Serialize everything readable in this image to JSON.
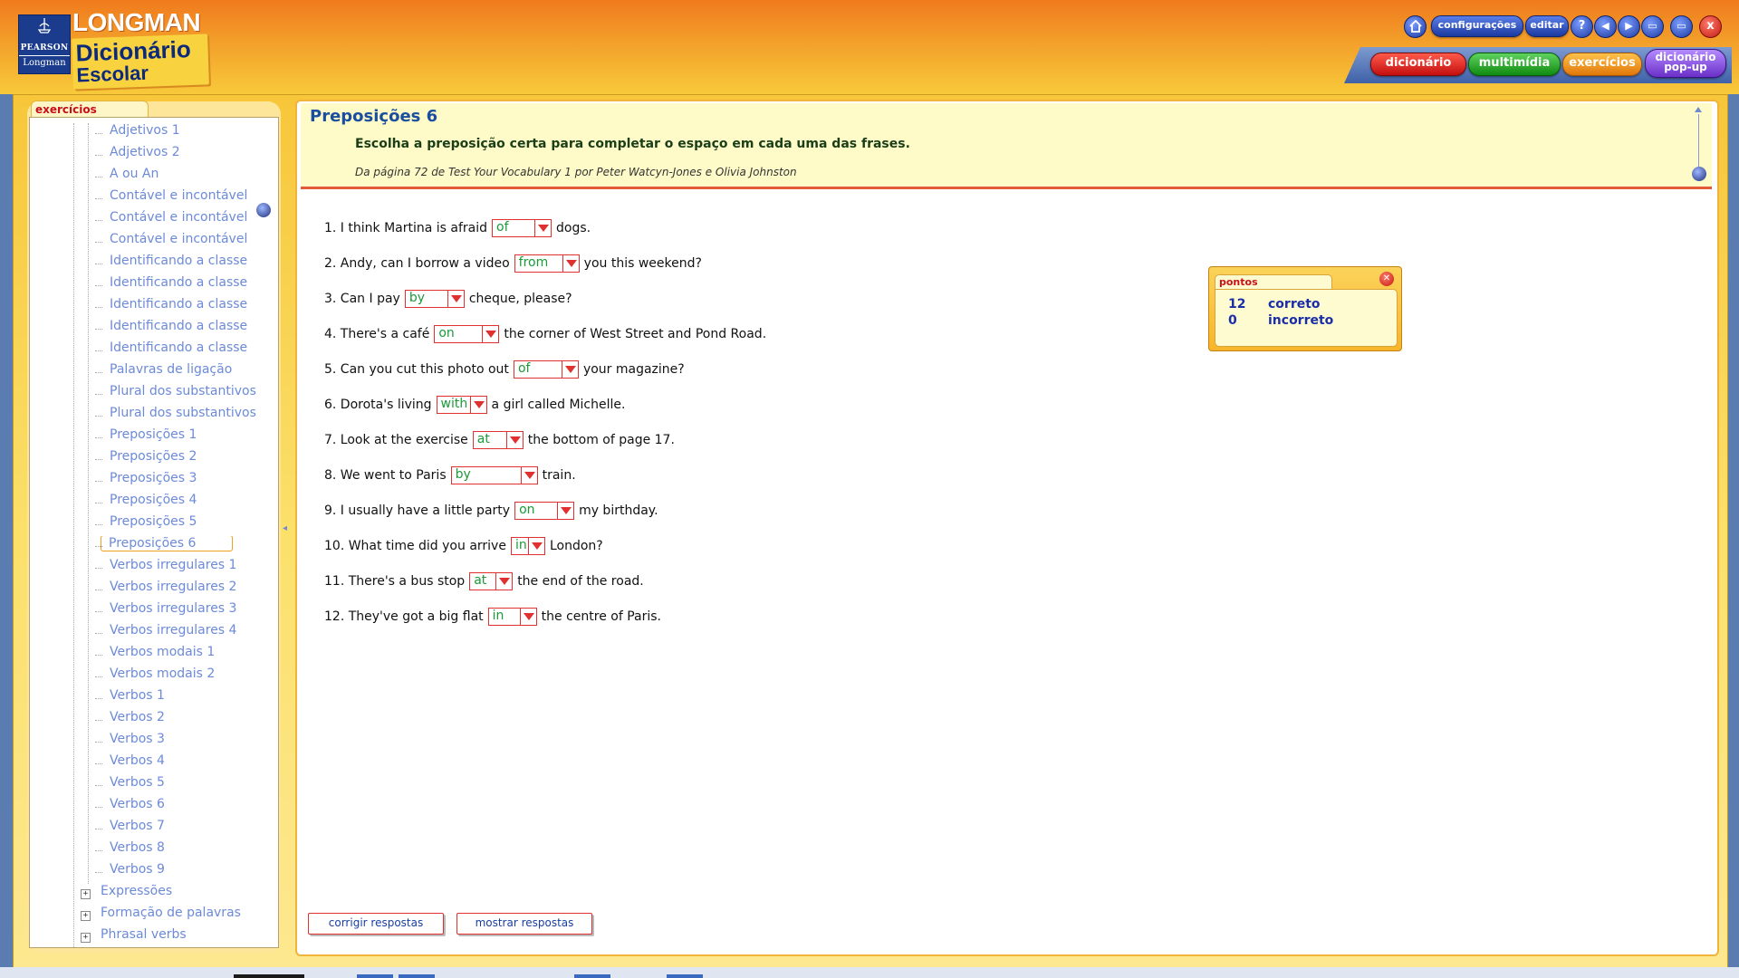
{
  "brand": {
    "publisher": "PEARSON",
    "imprint": "Longman",
    "name": "LONGMAN",
    "title_line1": "Dicionário",
    "title_line2": "Escolar"
  },
  "toolbar": {
    "home_icon": "home-icon",
    "configuracoes": "configurações",
    "editar": "editar",
    "help": "?",
    "back_icon": "arrow-left-icon",
    "forward_icon": "arrow-right-icon",
    "minimize_icon": "minimize-icon",
    "maximize_icon": "maximize-icon",
    "close": "x"
  },
  "section_tabs": {
    "dicionario": "dicionário",
    "multimidia": "multimídia",
    "exercicios": "exercícios",
    "popup_line1": "dicionário",
    "popup_line2": "pop-up"
  },
  "sidebar": {
    "tab_label": "exercícios",
    "items": [
      "Adjetivos 1",
      "Adjetivos 2",
      "A ou An",
      "Contável e incontável",
      "Contável e incontável",
      "Contável e incontável",
      "Identificando a classe",
      "Identificando a classe",
      "Identificando a classe",
      "Identificando a classe",
      "Identificando a classe",
      "Palavras de ligação",
      "Plural dos substantivos",
      "Plural dos substantivos",
      "Preposições 1",
      "Preposições 2",
      "Preposições 3",
      "Preposições 4",
      "Preposições 5",
      "Preposições 6",
      "Verbos irregulares 1",
      "Verbos irregulares 2",
      "Verbos irregulares 3",
      "Verbos irregulares 4",
      "Verbos modais 1",
      "Verbos modais 2",
      "Verbos 1",
      "Verbos 2",
      "Verbos 3",
      "Verbos 4",
      "Verbos 5",
      "Verbos 6",
      "Verbos 7",
      "Verbos 8",
      "Verbos 9"
    ],
    "selected": "Preposições 6",
    "top_items": [
      "Expressões",
      "Formação de palavras",
      "Phrasal verbs"
    ]
  },
  "exercise": {
    "title": "Preposições 6",
    "instruction": "Escolha a preposição certa para completar o espaço em cada uma das frases.",
    "source": "Da página 72 de Test Your Vocabulary 1 por Peter Watcyn-Jones e Olivia Johnston",
    "questions": [
      {
        "before": "1. I think Martina is afraid",
        "answer": "of",
        "after": "dogs."
      },
      {
        "before": "2. Andy, can I borrow a video",
        "answer": "from",
        "after": "you this weekend?"
      },
      {
        "before": "3. Can I pay",
        "answer": "by",
        "after": "cheque, please?"
      },
      {
        "before": "4. There's a café",
        "answer": "on",
        "after": "the corner of West Street and Pond Road."
      },
      {
        "before": "5. Can you cut this photo out",
        "answer": "of",
        "after": "your magazine?"
      },
      {
        "before": "6. Dorota's living",
        "answer": "with",
        "after": "a girl called Michelle."
      },
      {
        "before": "7. Look at the exercise",
        "answer": "at",
        "after": "the bottom of page 17."
      },
      {
        "before": "8. We went to Paris",
        "answer": "by",
        "after": "train."
      },
      {
        "before": "9. I usually have a little party",
        "answer": "on",
        "after": "my birthday."
      },
      {
        "before": "10. What time did you arrive",
        "answer": "in",
        "after": "London?"
      },
      {
        "before": "11. There's a bus stop",
        "answer": "at",
        "after": "the end of the road."
      },
      {
        "before": "12. They've got a big flat",
        "answer": "in",
        "after": "the centre of Paris."
      }
    ],
    "buttons": {
      "check": "corrigir respostas",
      "show": "mostrar respostas"
    }
  },
  "score": {
    "tab_label": "pontos",
    "correct_count": "12",
    "correct_label": "correto",
    "incorrect_count": "0",
    "incorrect_label": "incorreto"
  },
  "colors": {
    "header_top": "#f07a1e",
    "header_bottom": "#f8c93a",
    "link_blue": "#6c8ad8",
    "answer_green": "#1c9a3a",
    "select_border": "#e03030",
    "title_blue": "#1a4fa0"
  }
}
